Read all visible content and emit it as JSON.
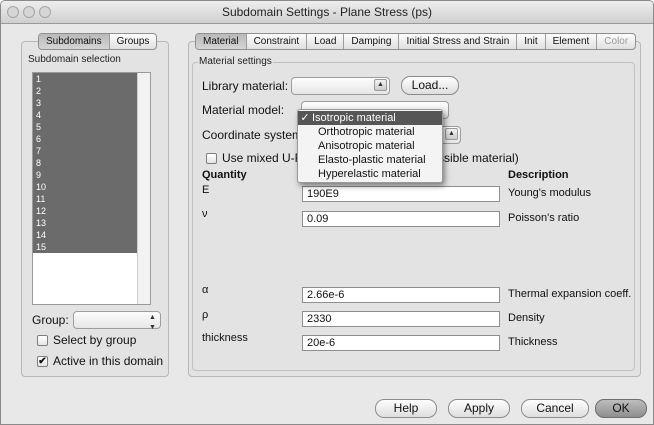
{
  "window": {
    "title": "Subdomain Settings - Plane Stress (ps)"
  },
  "left_tabs": [
    "Subdomains",
    "Groups"
  ],
  "subdomain_selection": {
    "legend": "Subdomain selection",
    "items": [
      "1",
      "2",
      "3",
      "4",
      "5",
      "6",
      "7",
      "8",
      "9",
      "10",
      "11",
      "12",
      "13",
      "14",
      "15"
    ]
  },
  "group": {
    "label": "Group:",
    "value": ""
  },
  "checkboxes": {
    "select_by_group": {
      "label": "Select by group",
      "checked": false
    },
    "active_in_domain": {
      "label": "Active in this domain",
      "checked": true
    }
  },
  "tabs": [
    {
      "label": "Material",
      "active": true,
      "enabled": true
    },
    {
      "label": "Constraint",
      "active": false,
      "enabled": true
    },
    {
      "label": "Load",
      "active": false,
      "enabled": true
    },
    {
      "label": "Damping",
      "active": false,
      "enabled": true
    },
    {
      "label": "Initial Stress and Strain",
      "active": false,
      "enabled": true
    },
    {
      "label": "Init",
      "active": false,
      "enabled": true
    },
    {
      "label": "Element",
      "active": false,
      "enabled": true
    },
    {
      "label": "Color",
      "active": false,
      "enabled": false
    }
  ],
  "material_settings": {
    "legend": "Material settings",
    "library_material_label": "Library material:",
    "library_material_value": "",
    "load_button": "Load...",
    "material_model_label": "Material model:",
    "coordinate_system_label": "Coordinate system:",
    "mixed_checkbox_label": "Use mixed U-P f",
    "mixed_checkbox_label_tail": "ssible material)",
    "quantity_header": "Quantity",
    "description_header": "Description"
  },
  "material_model_menu": {
    "items": [
      {
        "label": "Isotropic material",
        "selected": true
      },
      {
        "label": "Orthotropic material",
        "selected": false
      },
      {
        "label": "Anisotropic material",
        "selected": false
      },
      {
        "label": "Elasto-plastic material",
        "selected": false
      },
      {
        "label": "Hyperelastic material",
        "selected": false
      }
    ],
    "check_glyph": "✓"
  },
  "quantities": [
    {
      "symbol": "E",
      "value": "190E9",
      "description": "Young's modulus"
    },
    {
      "symbol": "ν",
      "value": "0.09",
      "description": "Poisson's ratio"
    },
    {
      "symbol": "α",
      "value": "2.66e-6",
      "description": "Thermal expansion coeff."
    },
    {
      "symbol": "ρ",
      "value": "2330",
      "description": "Density"
    },
    {
      "symbol": "thickness",
      "value": "20e-6",
      "description": "Thickness"
    }
  ],
  "buttons": {
    "help": "Help",
    "apply": "Apply",
    "cancel": "Cancel",
    "ok": "OK"
  }
}
